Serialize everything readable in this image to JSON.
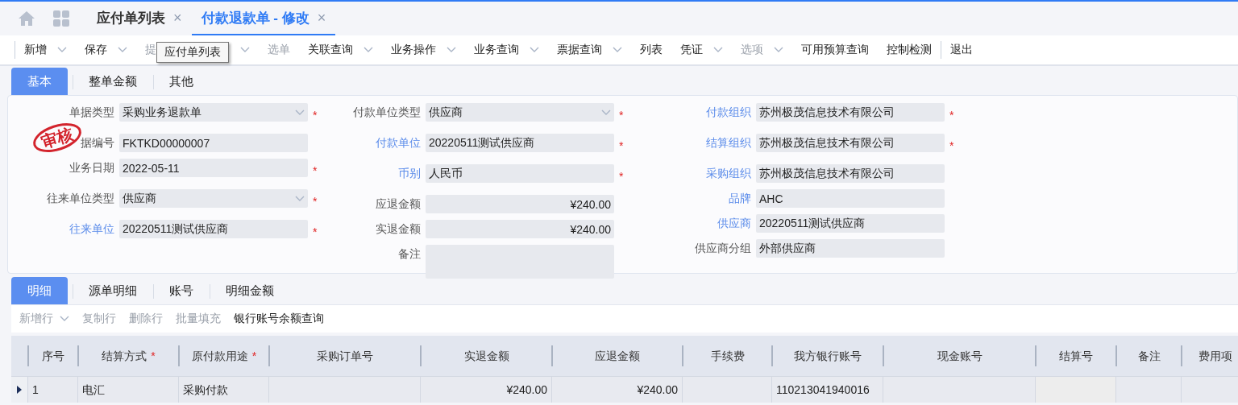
{
  "nav": {
    "tabs": [
      {
        "label": "应付单列表",
        "close": "×",
        "selected": false
      },
      {
        "label": "付款退款单 - 修改",
        "close": "×",
        "selected": true
      }
    ]
  },
  "toolbar": {
    "items": [
      {
        "label": "新增",
        "has_menu": true,
        "disabled": false,
        "separator_before": false
      },
      {
        "label": "保存",
        "has_menu": true,
        "disabled": false,
        "separator_before": false
      },
      {
        "label": "提",
        "has_menu": true,
        "disabled": true,
        "separator_before": false
      },
      {
        "label": "选单",
        "has_menu": false,
        "disabled": true,
        "separator_before": false
      },
      {
        "label": "关联查询",
        "has_menu": true,
        "disabled": false,
        "separator_before": false
      },
      {
        "label": "业务操作",
        "has_menu": true,
        "disabled": false,
        "separator_before": false
      },
      {
        "label": "业务查询",
        "has_menu": true,
        "disabled": false,
        "separator_before": false
      },
      {
        "label": "票据查询",
        "has_menu": true,
        "disabled": false,
        "separator_before": false
      },
      {
        "label": "列表",
        "has_menu": false,
        "disabled": false,
        "separator_before": false
      },
      {
        "label": "凭证",
        "has_menu": true,
        "disabled": false,
        "separator_before": false
      },
      {
        "label": "选项",
        "has_menu": true,
        "disabled": true,
        "separator_before": false
      },
      {
        "label": "可用预算查询",
        "has_menu": false,
        "disabled": false,
        "separator_before": false
      },
      {
        "label": "控制检测",
        "has_menu": false,
        "disabled": false,
        "separator_before": false
      },
      {
        "label": "退出",
        "has_menu": false,
        "disabled": false,
        "separator_before": true
      }
    ],
    "tooltip": "应付单列表"
  },
  "form_tabs": [
    {
      "label": "基本",
      "selected": true
    },
    {
      "label": "整单金额",
      "selected": false
    },
    {
      "label": "其他",
      "selected": false
    }
  ],
  "form": {
    "stamp": "审核",
    "columns": [
      [
        {
          "label": "单据类型",
          "link": false,
          "kind": "select",
          "value": "采购业务退款单",
          "required_mark": "*"
        },
        {
          "label": "据编号",
          "link": false,
          "kind": "text",
          "value": "FKTKD00000007"
        },
        {
          "label": "业务日期",
          "link": false,
          "kind": "text",
          "value": "2022-05-11",
          "required_mark": "*"
        },
        {
          "label": "往来单位类型",
          "link": false,
          "kind": "select",
          "value": "供应商",
          "required_mark": "*"
        },
        {
          "label": "往来单位",
          "link": true,
          "kind": "text",
          "value": "20220511测试供应商",
          "required_mark": "*"
        }
      ],
      [
        {
          "label": "付款单位类型",
          "link": false,
          "kind": "select",
          "value": "供应商",
          "required_mark": "*"
        },
        {
          "label": "付款单位",
          "link": true,
          "kind": "text",
          "value": "20220511测试供应商",
          "required_mark": "*"
        },
        {
          "label": "币别",
          "link": true,
          "kind": "text",
          "value": "人民币",
          "required_mark": "*"
        },
        {
          "label": "应退金额",
          "link": false,
          "kind": "amount",
          "value": "¥240.00"
        },
        {
          "label": "实退金额",
          "link": false,
          "kind": "amount",
          "value": "¥240.00"
        },
        {
          "label": "备注",
          "link": false,
          "kind": "memo"
        }
      ],
      [
        {
          "label": "付款组织",
          "link": true,
          "kind": "text",
          "value": "苏州极茂信息技术有限公司",
          "required_mark": "*"
        },
        {
          "label": "结算组织",
          "link": true,
          "kind": "text",
          "value": "苏州极茂信息技术有限公司",
          "required_mark": "*"
        },
        {
          "label": "采购组织",
          "link": true,
          "kind": "text",
          "value": "苏州极茂信息技术有限公司"
        },
        {
          "label": "品牌",
          "link": true,
          "kind": "text",
          "value": "AHC"
        },
        {
          "label": "供应商",
          "link": true,
          "kind": "text",
          "value": "20220511测试供应商"
        },
        {
          "label": "供应商分组",
          "link": false,
          "kind": "text",
          "value": "外部供应商"
        }
      ]
    ]
  },
  "detail_tabs": [
    {
      "label": "明细",
      "selected": true
    },
    {
      "label": "源单明细",
      "selected": false
    },
    {
      "label": "账号",
      "selected": false
    },
    {
      "label": "明细金额",
      "selected": false
    }
  ],
  "detail_toolbar": [
    {
      "label": "新增行",
      "has_menu": true,
      "disabled": true
    },
    {
      "label": "复制行",
      "has_menu": false,
      "disabled": true
    },
    {
      "label": "删除行",
      "has_menu": false,
      "disabled": true
    },
    {
      "label": "批量填充",
      "has_menu": false,
      "disabled": true
    },
    {
      "label": "银行账号余额查询",
      "has_menu": false,
      "disabled": false
    }
  ],
  "table": {
    "columns": [
      {
        "label": "序号"
      },
      {
        "label": "结算方式",
        "required_mark": "*"
      },
      {
        "label": "原付款用途",
        "required_mark": "*"
      },
      {
        "label": "采购订单号"
      },
      {
        "label": "实退金额"
      },
      {
        "label": "应退金额"
      },
      {
        "label": "手续费"
      },
      {
        "label": "我方银行账号"
      },
      {
        "label": "现金账号"
      },
      {
        "label": "结算号"
      },
      {
        "label": "备注"
      },
      {
        "label": "费用项"
      }
    ],
    "rows": [
      {
        "current": true,
        "cells": [
          "1",
          "电汇",
          "采购付款",
          "",
          "¥240.00",
          "¥240.00",
          "",
          "110213041940016",
          "",
          "",
          "",
          ""
        ]
      }
    ]
  }
}
